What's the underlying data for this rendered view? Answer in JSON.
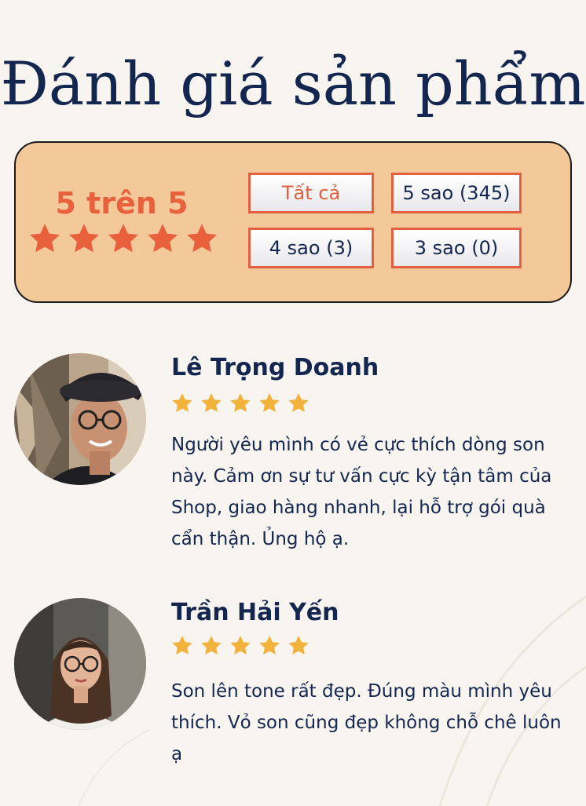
{
  "page": {
    "title": "Đánh giá sản phẩm"
  },
  "summary": {
    "score_text": "5 trên 5",
    "rating": 5,
    "max_rating": 5
  },
  "filters": [
    {
      "label": "Tất cả",
      "active": true
    },
    {
      "label": "5 sao (345)",
      "active": false
    },
    {
      "label": "4 sao (3)",
      "active": false
    },
    {
      "label": "3 sao (0)",
      "active": false
    }
  ],
  "reviews": [
    {
      "name": "Lê Trọng Doanh",
      "rating": 5,
      "text": "Người yêu mình có vẻ cực thích dòng son này. Cảm ơn sự tư vấn cực kỳ tận tâm của Shop, giao hàng nhanh, lại hỗ trợ gói quà cẩn thận. Ủng hộ ạ."
    },
    {
      "name": "Trần Hải Yến",
      "rating": 5,
      "text": "Son lên tone rất đẹp. Đúng màu mình yêu thích. Vỏ son cũng đẹp không chỗ chê luôn ạ"
    }
  ],
  "colors": {
    "navy": "#13264f",
    "accent": "#e8603c",
    "summary_bg": "#f3c99a",
    "review_star": "#f2b33d",
    "page_bg": "#f8f4ef"
  },
  "icons": {
    "summary_star": "star-icon",
    "review_star": "star-icon"
  }
}
